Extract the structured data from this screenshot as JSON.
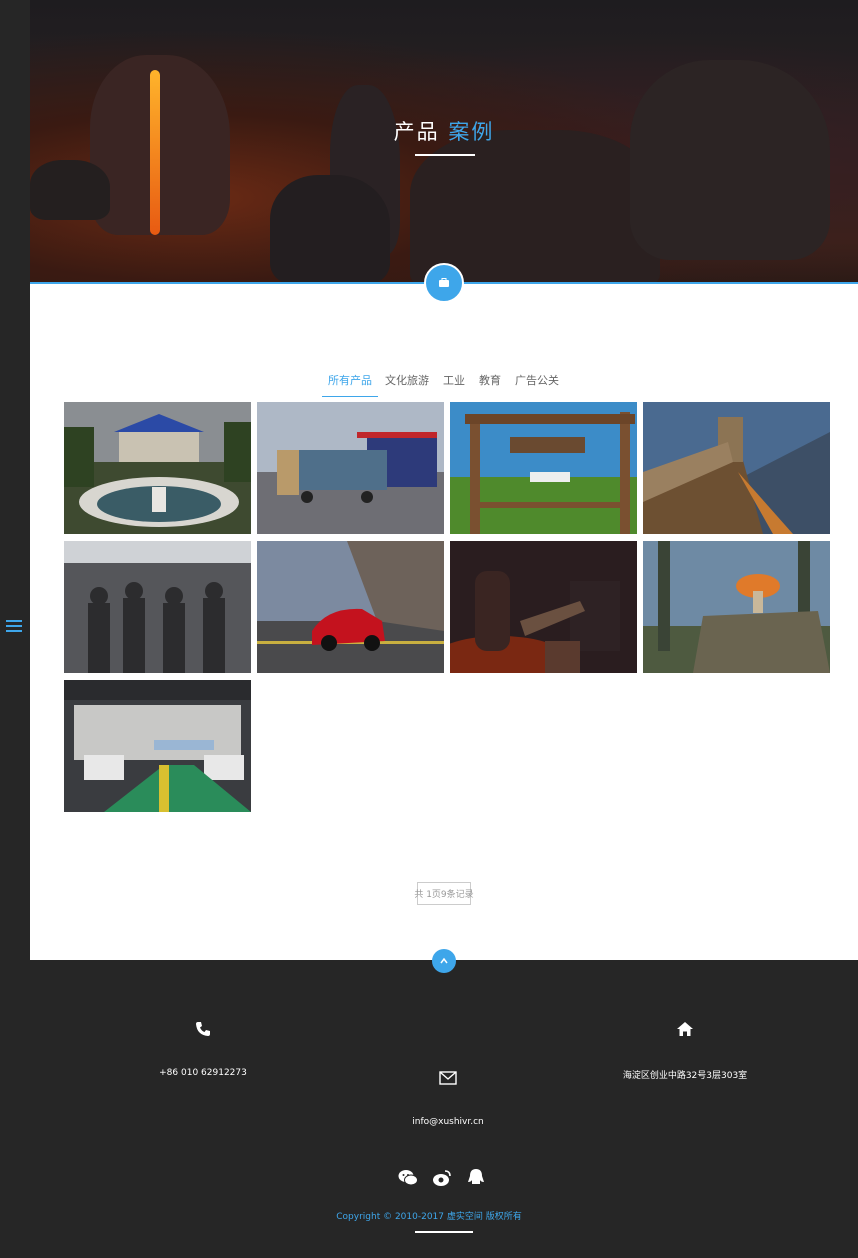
{
  "hero": {
    "title_main": "产品",
    "title_accent": "案例"
  },
  "tabs": [
    {
      "label": "所有产品",
      "active": true
    },
    {
      "label": "文化旅游",
      "active": false
    },
    {
      "label": "工业",
      "active": false
    },
    {
      "label": "教育",
      "active": false
    },
    {
      "label": "广告公关",
      "active": false
    }
  ],
  "gallery": [
    {
      "icon": "palace-thumbnail"
    },
    {
      "icon": "container-truck-thumbnail"
    },
    {
      "icon": "farm-gate-thumbnail"
    },
    {
      "icon": "great-wall-thumbnail"
    },
    {
      "icon": "terracotta-warriors-thumbnail"
    },
    {
      "icon": "red-car-thumbnail"
    },
    {
      "icon": "volcano-bridge-thumbnail"
    },
    {
      "icon": "mushroom-house-thumbnail"
    },
    {
      "icon": "factory-hall-thumbnail"
    }
  ],
  "pagination": {
    "text": "共 1页9条记录"
  },
  "footer": {
    "phone": "+86 010 62912273",
    "email": "info@xushivr.cn",
    "address": "海淀区创业中路32号3层303室",
    "copyright": "Copyright © 2010-2017 虚实空间 版权所有"
  },
  "colors": {
    "accent": "#3ea6ea",
    "footer_bg": "#262626",
    "rail_bg": "#262626"
  }
}
